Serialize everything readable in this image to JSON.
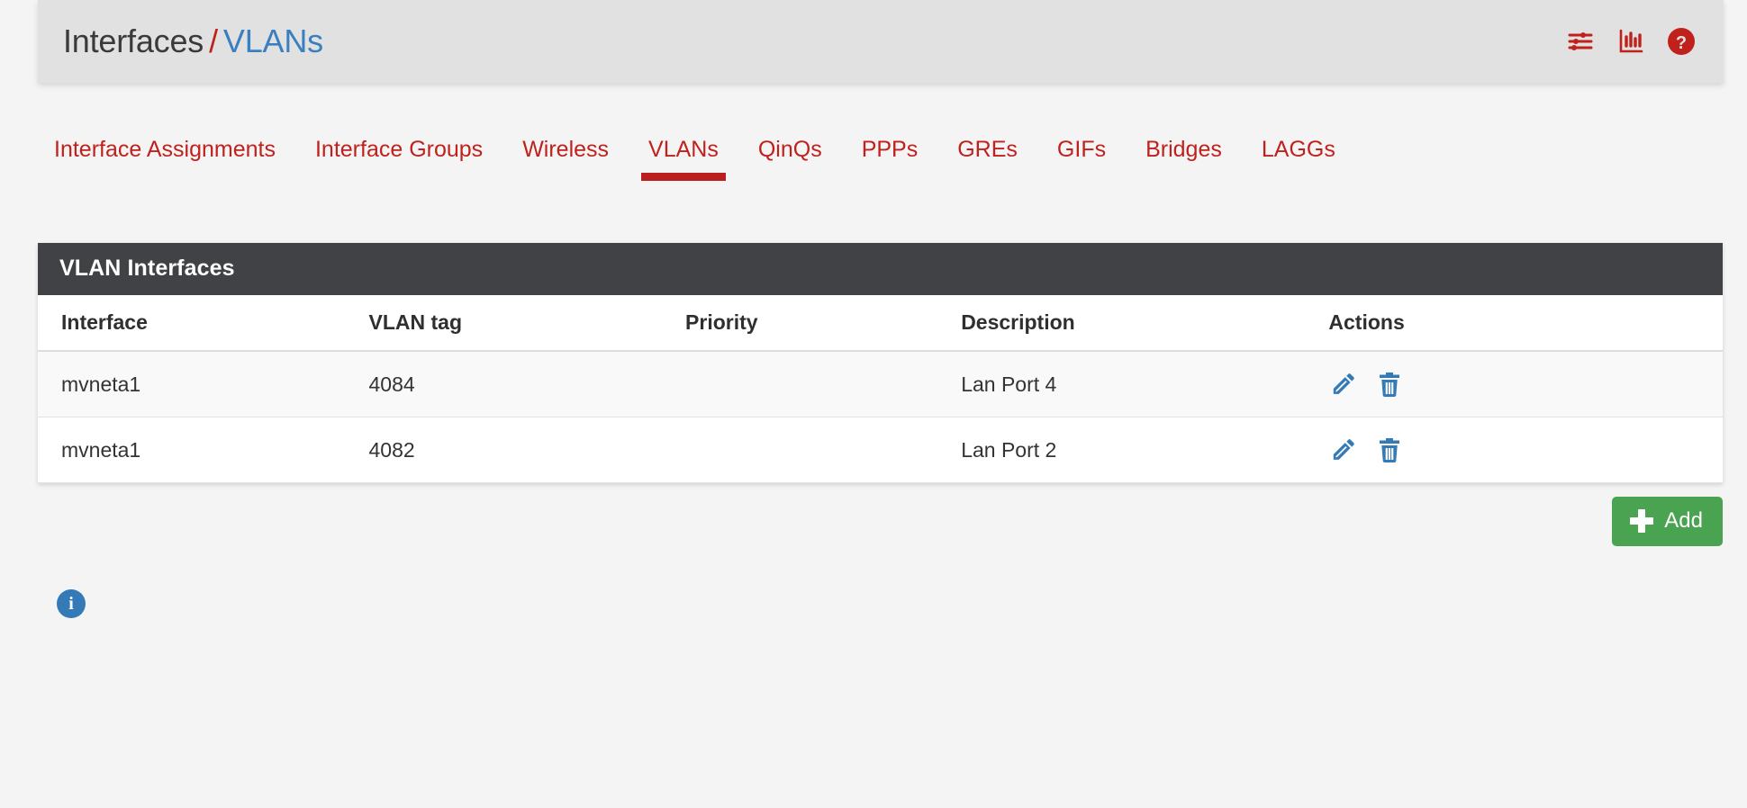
{
  "header": {
    "breadcrumb": {
      "parent": "Interfaces",
      "separator": "/",
      "current": "VLANs"
    },
    "icons": [
      {
        "name": "sliders-icon",
        "title": "Display settings"
      },
      {
        "name": "chart-bar-icon",
        "title": "Status monitoring"
      },
      {
        "name": "help-circle-icon",
        "title": "Help"
      }
    ],
    "accent_red": "#c0211c",
    "link_blue": "#3a7fbf",
    "bar_background": "#e1e1e1"
  },
  "tabs": [
    {
      "label": "Interface Assignments",
      "active": false
    },
    {
      "label": "Interface Groups",
      "active": false
    },
    {
      "label": "Wireless",
      "active": false
    },
    {
      "label": "VLANs",
      "active": true
    },
    {
      "label": "QinQs",
      "active": false
    },
    {
      "label": "PPPs",
      "active": false
    },
    {
      "label": "GREs",
      "active": false
    },
    {
      "label": "GIFs",
      "active": false
    },
    {
      "label": "Bridges",
      "active": false
    },
    {
      "label": "LAGGs",
      "active": false
    }
  ],
  "panel": {
    "title": "VLAN Interfaces",
    "title_background": "#404245",
    "columns": [
      "Interface",
      "VLAN tag",
      "Priority",
      "Description",
      "Actions"
    ],
    "rows": [
      {
        "interface": "mvneta1",
        "vlan_tag": "4084",
        "priority": "",
        "description": "Lan Port 4",
        "actions": [
          {
            "name": "edit-vlan-icon",
            "label": "Edit"
          },
          {
            "name": "delete-vlan-icon",
            "label": "Delete"
          }
        ]
      },
      {
        "interface": "mvneta1",
        "vlan_tag": "4082",
        "priority": "",
        "description": "Lan Port 2",
        "actions": [
          {
            "name": "edit-vlan-icon",
            "label": "Edit"
          },
          {
            "name": "delete-vlan-icon",
            "label": "Delete"
          }
        ]
      }
    ],
    "action_icon_color": "#337ab7"
  },
  "add_button": {
    "label": "Add",
    "icon": "plus-icon",
    "color": "#4aa350"
  },
  "info": {
    "icon": "info-circle-icon",
    "glyph": "i",
    "color": "#337ab7"
  }
}
